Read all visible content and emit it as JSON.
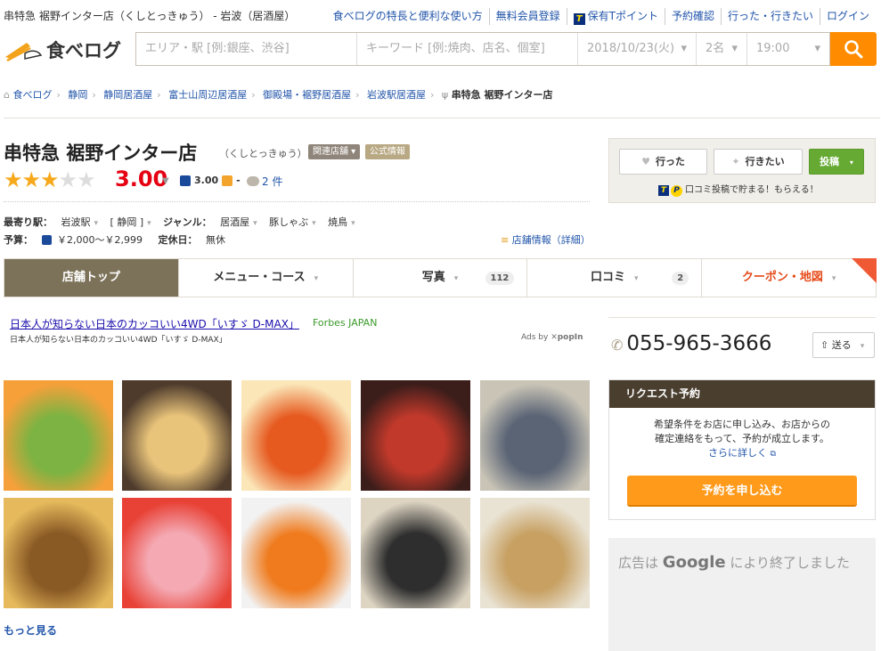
{
  "top": {
    "page_title": "串特急 裾野インター店（くしとっきゅう） - 岩波（居酒屋）",
    "links": [
      "食べログの特長と便利な使い方",
      "無料会員登録",
      "保有Tポイント",
      "予約確認",
      "行った・行きたい",
      "ログイン"
    ]
  },
  "header": {
    "logo_text": "食べログ",
    "area_placeholder": "エリア・駅 [例:銀座、渋谷]",
    "keyword_placeholder": "キーワード [例:焼肉、店名、個室]",
    "date": "2018/10/23(火)",
    "people": "2名",
    "time": "19:00"
  },
  "breadcrumb": [
    "食べログ",
    "静岡",
    "静岡居酒屋",
    "富士山周辺居酒屋",
    "御殿場・裾野居酒屋",
    "岩波駅居酒屋",
    "串特急 裾野インター店"
  ],
  "restaurant": {
    "name": "串特急 裾野インター店",
    "kana": "（くしとっきゅう）",
    "tag_related": "関連店舗",
    "tag_official": "公式情報",
    "rating": 3.0,
    "score": "3.00",
    "night_score": "3.00",
    "lunch_score": "-",
    "review_count": "2 件",
    "station_label": "最寄り駅：",
    "station": "岩波駅",
    "station_pref": "[ 静岡 ]",
    "genre_label": "ジャンル：",
    "genres": [
      "居酒屋",
      "豚しゃぶ",
      "焼鳥"
    ],
    "budget_label": "予算：",
    "budget": "￥2,000～￥2,999",
    "holiday_label": "定休日：",
    "holiday": "無休",
    "detail_link": "店舗情報（詳細）"
  },
  "actions": {
    "went": "行った",
    "want": "行きたい",
    "post": "投稿",
    "note": "口コミ投稿で貯まる！もらえる！"
  },
  "tabs": [
    {
      "label": "店舗トップ",
      "count": ""
    },
    {
      "label": "メニュー・コース",
      "count": ""
    },
    {
      "label": "写真",
      "count": "112"
    },
    {
      "label": "口コミ",
      "count": "2"
    },
    {
      "label": "クーポン・地図",
      "count": ""
    }
  ],
  "ad": {
    "title": "日本人が知らない日本のカッコいい4WD「いすゞ D-MAX」",
    "source": "Forbes JAPAN",
    "subtitle": "日本人が知らない日本のカッコいい4WD「いすゞ D-MAX」",
    "ads_by": "Ads by",
    "ads_brand": "popIn"
  },
  "photos": [
    {
      "name": "salad",
      "c1": "#f6a03a",
      "c2": "#7cb342"
    },
    {
      "name": "agedashi",
      "c1": "#4e3b2c",
      "c2": "#e8c37a"
    },
    {
      "name": "fries",
      "c1": "#fbe6b8",
      "c2": "#e65a20"
    },
    {
      "name": "kushi-signboard",
      "c1": "#3b1d1a",
      "c2": "#c0392b"
    },
    {
      "name": "banquet-room",
      "c1": "#c9c4b6",
      "c2": "#5a6475"
    },
    {
      "name": "tatami-room",
      "c1": "#e5b95c",
      "c2": "#8a5a25"
    },
    {
      "name": "pork-bowl",
      "c1": "#e84135",
      "c2": "#f4a9b3"
    },
    {
      "name": "highball",
      "c1": "#f2f2f2",
      "c2": "#ef7b1e"
    },
    {
      "name": "onigiri",
      "c1": "#ddd4c2",
      "c2": "#2e2e2e"
    },
    {
      "name": "ochazuke",
      "c1": "#e9e3d4",
      "c2": "#c7a062"
    }
  ],
  "more_link": "もっと見る",
  "side": {
    "phone": "055-965-3666",
    "send": "送る",
    "request_head": "リクエスト予約",
    "request_text1": "希望条件をお店に申し込み、お店からの",
    "request_text2": "確定連絡をもって、予約が成立します。",
    "request_more": "さらに詳しく",
    "request_btn": "予約を申し込む",
    "ad_ended_pre": "広告は",
    "ad_ended_brand": "Google",
    "ad_ended_post": "により終了しました"
  },
  "colors": {
    "accent": "#ff8c00",
    "score": "#e50012",
    "link": "#2255aa",
    "tab_active": "#7c7259"
  }
}
